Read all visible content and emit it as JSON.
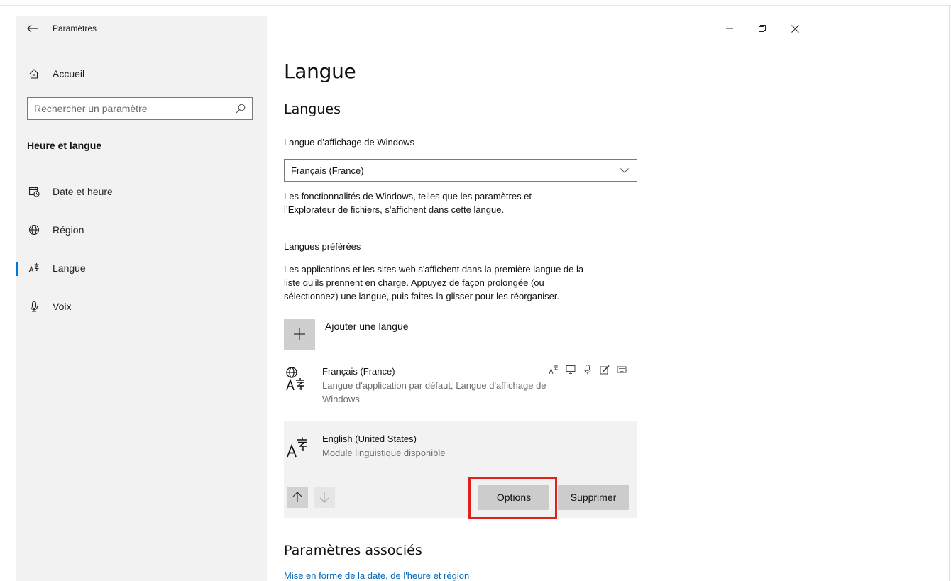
{
  "app": {
    "title": "Paramètres"
  },
  "window_controls": {
    "minimize": "–",
    "restore": "❐",
    "close": "✕"
  },
  "sidebar": {
    "home_label": "Accueil",
    "search_placeholder": "Rechercher un paramètre",
    "section_title": "Heure et langue",
    "items": [
      {
        "label": "Date et heure",
        "icon": "calendar-clock-icon",
        "selected": false
      },
      {
        "label": "Région",
        "icon": "globe-icon",
        "selected": false
      },
      {
        "label": "Langue",
        "icon": "language-icon",
        "selected": true
      },
      {
        "label": "Voix",
        "icon": "microphone-icon",
        "selected": false
      }
    ]
  },
  "main": {
    "page_title": "Langue",
    "languages_heading": "Langues",
    "display_language_label": "Langue d’affichage de Windows",
    "display_language_value": "Français (France)",
    "display_language_desc_line1": "Les fonctionnalités de Windows, telles que les paramètres et",
    "display_language_desc_line2": "l’Explorateur de fichiers, s'affichent dans cette langue.",
    "preferred_label": "Langues préférées",
    "preferred_desc_line1": "Les applications et les sites web s'affichent dans la première langue de la",
    "preferred_desc_line2": "liste qu'ils prennent en charge. Appuyez de façon prolongée (ou",
    "preferred_desc_line3": "sélectionnez) une langue, puis faites-la glisser pour les réorganiser.",
    "add_language_label": "Ajouter une langue",
    "languages": [
      {
        "name": "Français (France)",
        "subtitle_line1": "Langue d'application par défaut, Langue d'affichage de",
        "subtitle_line2": "Windows",
        "feature_icons": [
          "language-pack-icon",
          "display-icon",
          "microphone-icon",
          "handwriting-icon",
          "keyboard-icon"
        ]
      },
      {
        "name": "English (United States)",
        "subtitle_line1": "Module linguistique disponible",
        "selected": true
      }
    ],
    "options_button": "Options",
    "remove_button": "Supprimer",
    "related_heading": "Paramètres associés",
    "related_link": "Mise en forme de la date, de l'heure et région"
  },
  "colors": {
    "accent": "#0078d4",
    "link": "#0067b8",
    "highlight": "#e0211c",
    "sidebar_bg": "#f2f2f2"
  }
}
